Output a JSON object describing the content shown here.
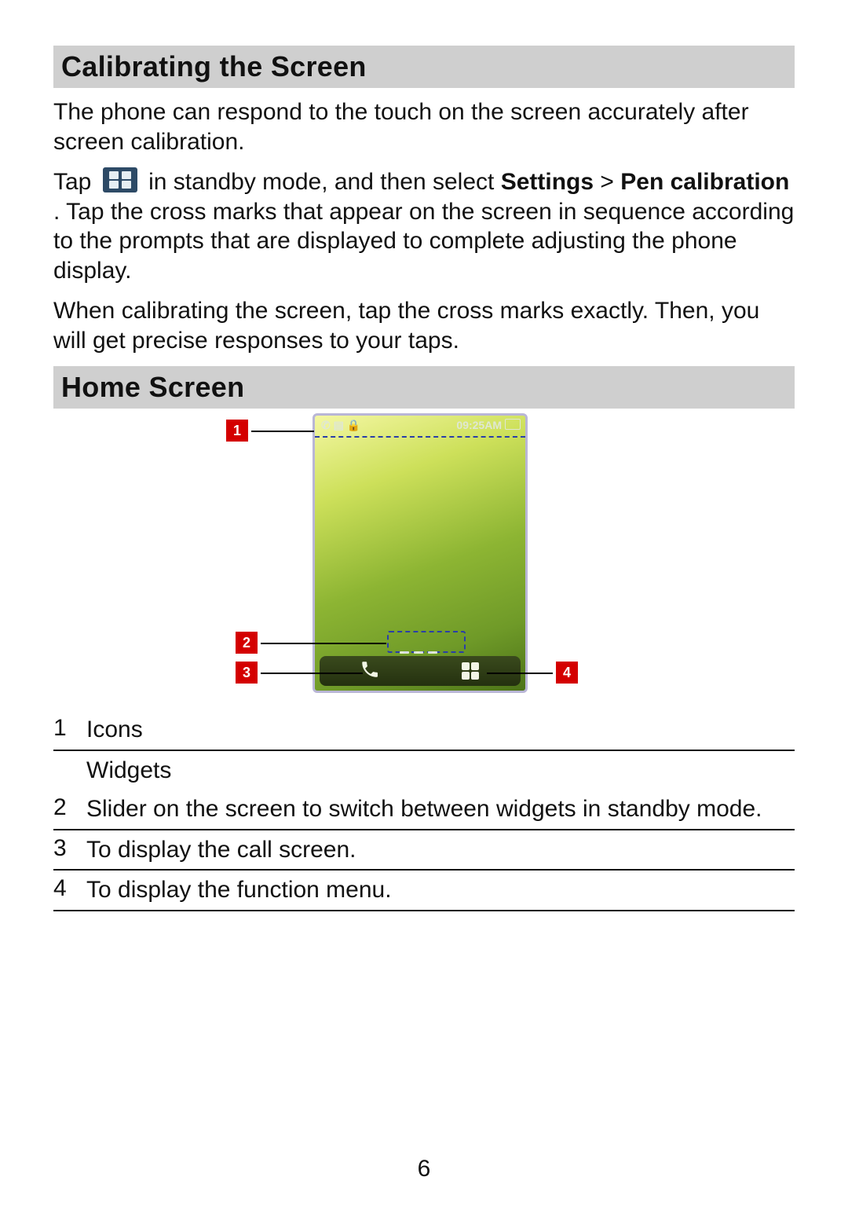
{
  "sections": {
    "calibrating_title": "Calibrating the Screen",
    "calibrating_p1": "The phone can respond to the touch on the screen accurately after screen calibration.",
    "calibrating_p2_a": "Tap ",
    "calibrating_p2_b": " in standby mode, and then select ",
    "calibrating_p2_bold1": "Settings",
    "calibrating_p2_gt": " > ",
    "calibrating_p2_bold2": "Pen calibration",
    "calibrating_p2_c": ". Tap the cross marks that appear on the screen in sequence according to the prompts that are displayed to complete adjusting the phone display.",
    "calibrating_p3": "When calibrating the screen, tap the cross marks exactly. Then, you will get precise responses to your taps.",
    "home_title": "Home Screen"
  },
  "phone": {
    "status_icons_text": "✆ ▤ 🔒",
    "time": "09:25AM"
  },
  "callouts": {
    "c1": "1",
    "c2": "2",
    "c3": "3",
    "c4": "4"
  },
  "legend": [
    {
      "num": "1",
      "text": "Icons"
    },
    {
      "num": "",
      "text": "Widgets"
    },
    {
      "num": "2",
      "text": "Slider on the screen to switch between widgets in standby mode."
    },
    {
      "num": "3",
      "text": "To display the call screen."
    },
    {
      "num": "4",
      "text": "To display the function menu."
    }
  ],
  "page_number": "6"
}
